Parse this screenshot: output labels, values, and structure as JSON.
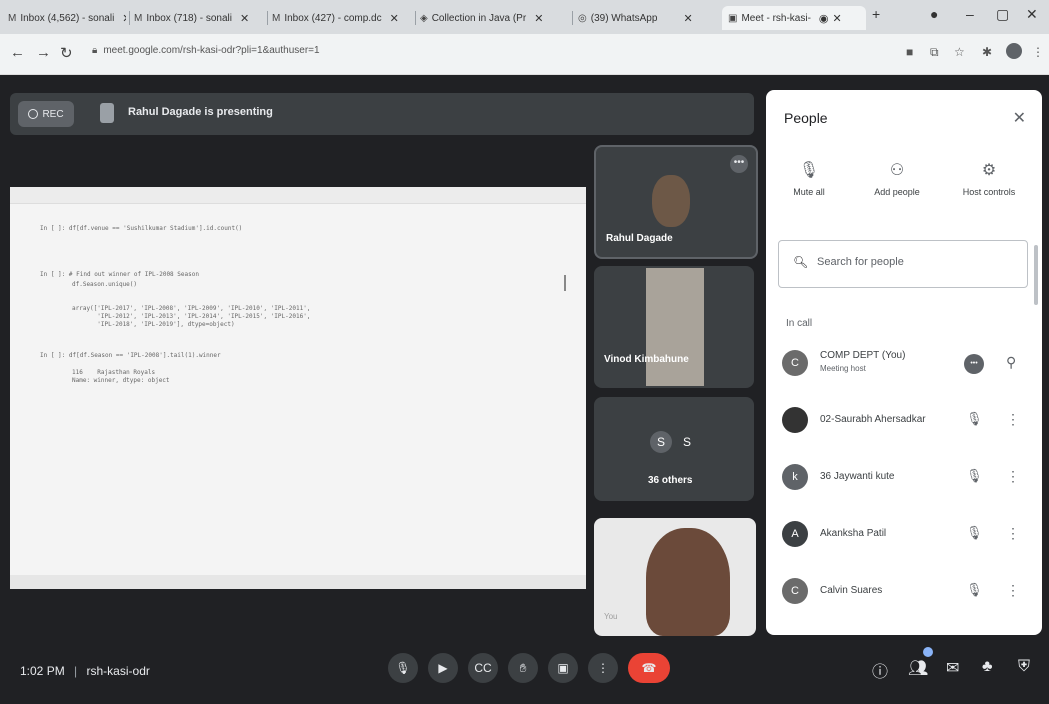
{
  "browser": {
    "tabs": [
      {
        "label": "Inbox (4,562) - sonali",
        "icon": "gmail-icon"
      },
      {
        "label": "Inbox (718) - sonali",
        "icon": "gmail-icon"
      },
      {
        "label": "Inbox (427) - comp.dc",
        "icon": "gmail-icon"
      },
      {
        "label": "Collection in Java (Pr",
        "icon": "collection-icon"
      },
      {
        "label": "(39) WhatsApp",
        "icon": "whatsapp-icon"
      },
      {
        "label": "Meet - rsh-kasi-",
        "icon": "meet-icon"
      }
    ],
    "url": "meet.google.com/rsh-kasi-odr?pli=1&authuser=1"
  },
  "meet": {
    "rec_label": "REC",
    "presenting_text": "Rahul Dagade is presenting",
    "code_lines": [
      "df[df.venue == 'Sushilkumar Stadium'].id.count()",
      "# Find out winner of IPL-2008 Season",
      "df.Season.unique()",
      "array(['IPL-2017', 'IPL-2008', 'IPL-2009', 'IPL-2010', 'IPL-2011',",
      "       'IPL-2012', 'IPL-2013', 'IPL-2014', 'IPL-2015', 'IPL-2016',",
      "       'IPL-2018', 'IPL-2019'], dtype=object)",
      "df[df.Season == 'IPL-2008'].tail(1).winner",
      "116    Rajasthan Royals",
      "Name: winner, dtype: object"
    ],
    "tiles": {
      "presenter_name": "Rahul Dagade",
      "second_name": "Vinod Kimbahune",
      "others_initial_1": "S",
      "others_initial_2": "S",
      "others_label": "36 others",
      "self_label": "You"
    },
    "time": "1:02 PM",
    "meeting_code": "rsh-kasi-odr",
    "separator": "|"
  },
  "people_panel": {
    "title": "People",
    "actions": [
      {
        "label": "Mute all",
        "icon": "mic-off-icon"
      },
      {
        "label": "Add people",
        "icon": "add-person-icon"
      },
      {
        "label": "Host controls",
        "icon": "host-controls-icon"
      }
    ],
    "search_placeholder": "Search for people",
    "section_label": "In call",
    "participants": [
      {
        "name": "COMP DEPT (You)",
        "sub": "Meeting host",
        "initial": "C",
        "color": "#6b6b6b"
      },
      {
        "name": "02-Saurabh Ahersadkar",
        "sub": "",
        "initial": "",
        "color": "#333333"
      },
      {
        "name": "36 Jaywanti kute",
        "sub": "",
        "initial": "k",
        "color": "#5f6368"
      },
      {
        "name": "Akanksha Patil",
        "sub": "",
        "initial": "A",
        "color": "#3c4043"
      },
      {
        "name": "Calvin Suares",
        "sub": "",
        "initial": "C",
        "color": "#6b6b6b"
      }
    ]
  }
}
